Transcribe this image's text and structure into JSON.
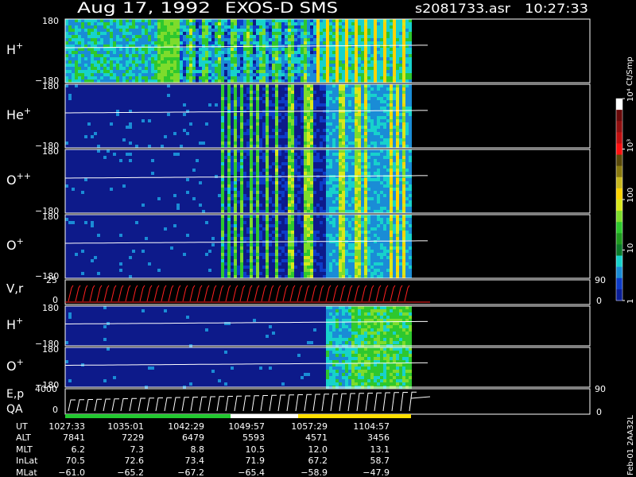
{
  "header": {
    "date": "Aug 17, 1992",
    "instrument": "EXOS-D SMS",
    "file": "s2081733.asr",
    "time": "10:27:33"
  },
  "colorbar": {
    "unit_label": "Ct/Smp",
    "tick_labels": [
      "1",
      "10",
      "100",
      "10³",
      "10⁴"
    ],
    "tick_values": [
      1,
      10,
      100,
      1000,
      10000
    ],
    "palette": [
      "#0a1e96",
      "#0d3cc8",
      "#1a8cd6",
      "#17d2cc",
      "#0b7a2a",
      "#1f9a1f",
      "#2ec82e",
      "#7ddc2c",
      "#d8e81c",
      "#ffd400",
      "#c8b820",
      "#8a7a10",
      "#5a4a0a",
      "#ff1010",
      "#c01010",
      "#901010",
      "#6a0a0a",
      "#ffffff"
    ]
  },
  "side_label": "Feb-01  2AA32L",
  "footer": {
    "row_labels": [
      "UT",
      "ALT",
      "MLT",
      "InLat",
      "MLat"
    ],
    "columns": [
      [
        "1027:33",
        "7841",
        "6.2",
        "70.5",
        "−61.0"
      ],
      [
        "1035:01",
        "7229",
        "7.3",
        "72.6",
        "−65.2"
      ],
      [
        "1042:29",
        "6479",
        "8.8",
        "73.4",
        "−67.2"
      ],
      [
        "1049:57",
        "5593",
        "10.5",
        "71.9",
        "−65.4"
      ],
      [
        "1057:29",
        "4571",
        "12.0",
        "67.2",
        "−58.9"
      ],
      [
        "1104:57",
        "3456",
        "13.1",
        "58.7",
        "−47.9"
      ]
    ]
  },
  "chart_data": [
    {
      "type": "heatmap",
      "panels": [
        {
          "key": "h1",
          "label": "H",
          "sup": "+",
          "ylim": [
            -180,
            180
          ],
          "ytick_top": "180",
          "ytick_bottom": "−180",
          "band_to": 1100.5,
          "band_pattern": "dense"
        },
        {
          "key": "he",
          "label": "He",
          "sup": "+",
          "ylim": [
            -180,
            180
          ],
          "ytick_top": "180",
          "ytick_bottom": "−180",
          "band_to": 1100.5,
          "band_pattern": "stripes"
        },
        {
          "key": "opp",
          "label": "O",
          "sup": "++",
          "ylim": [
            -180,
            180
          ],
          "ytick_top": "180",
          "ytick_bottom": "−180",
          "band_to": 1100.5,
          "band_pattern": "stripes"
        },
        {
          "key": "op",
          "label": "O",
          "sup": "+",
          "ylim": [
            -180,
            180
          ],
          "ytick_top": "180",
          "ytick_bottom": "−180",
          "band_to": 1100.5,
          "band_pattern": "stripes"
        },
        {
          "key": "h2",
          "label": "H",
          "sup": "+",
          "ylim": [
            -180,
            180
          ],
          "ytick_top": "180",
          "ytick_bottom": "−180",
          "band_to": 1100.5,
          "band_pattern": "late"
        },
        {
          "key": "o2",
          "label": "O",
          "sup": "+",
          "ylim": [
            -180,
            180
          ],
          "ytick_top": "180",
          "ytick_bottom": "−180",
          "band_to": 1100.5,
          "band_pattern": "late"
        }
      ],
      "x": {
        "label": "UT",
        "ticks": [
          "1027:33",
          "1035:01",
          "1042:29",
          "1049:57",
          "1057:29",
          "1104:57"
        ]
      }
    },
    {
      "type": "line",
      "panel": "V,r",
      "y_left": {
        "ticks": [
          "25",
          "0"
        ]
      },
      "y_right": {
        "ticks": [
          "90",
          "0"
        ]
      }
    },
    {
      "type": "line",
      "panel": "E,p QA",
      "y_left": {
        "ticks": [
          "4000",
          "0"
        ]
      },
      "y_right": {
        "ticks": [
          "90",
          "0"
        ]
      },
      "qa_segments": [
        {
          "color": "#22c830",
          "to": "1049:57"
        },
        {
          "color": "#ffffff",
          "to": "1057:29"
        },
        {
          "color": "#ffe000",
          "to": "end"
        }
      ]
    }
  ]
}
